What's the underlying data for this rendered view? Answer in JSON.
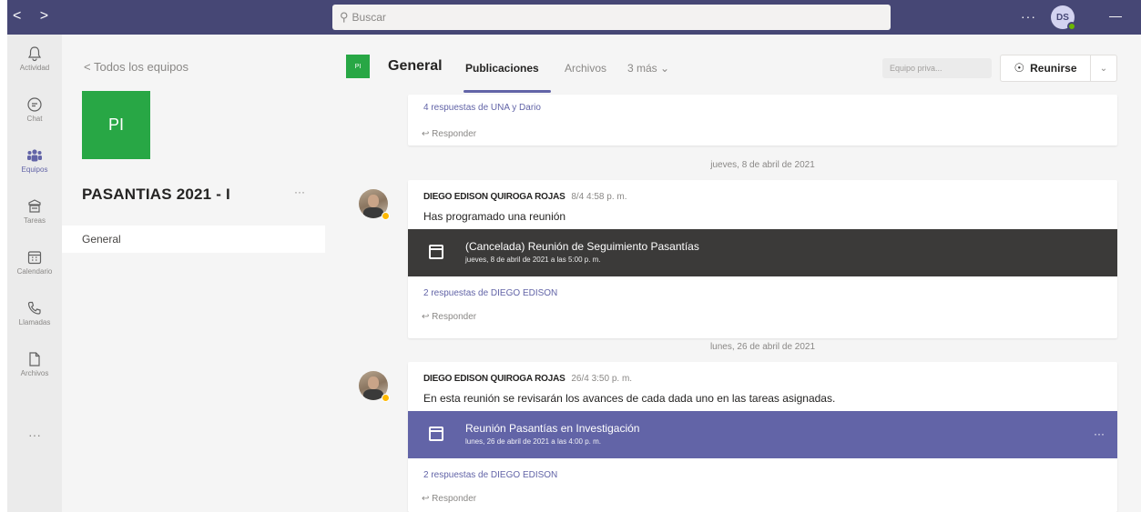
{
  "topbar": {
    "back": "<",
    "forward": ">",
    "search_placeholder": "Buscar",
    "more": "···",
    "user_initials": "DS",
    "minimize": "—"
  },
  "rail": [
    {
      "label": "Actividad",
      "icon": "bell-icon"
    },
    {
      "label": "Chat",
      "icon": "chat-icon"
    },
    {
      "label": "Equipos",
      "icon": "teams-icon",
      "active": true
    },
    {
      "label": "Tareas",
      "icon": "assignments-icon"
    },
    {
      "label": "Calendario",
      "icon": "calendar-icon"
    },
    {
      "label": "Llamadas",
      "icon": "phone-icon"
    },
    {
      "label": "Archivos",
      "icon": "files-icon"
    }
  ],
  "rail_more": "···",
  "team": {
    "back_label": "< Todos los equipos",
    "tile_initials": "PI",
    "name": "PASANTIAS 2021 - I",
    "more": "···",
    "channel": "General"
  },
  "header": {
    "tile_initials": "PI",
    "channel_title": "General",
    "tabs": [
      "Publicaciones",
      "Archivos",
      "3 más"
    ],
    "privacy": "Equipo priva...",
    "meet_label": "Reunirse",
    "meet_dropdown": "⌄"
  },
  "feed": {
    "top_replies": "4 respuestas de UNA y Dario",
    "reply_label": "Responder",
    "date1": "jueves, 8 de abril de 2021",
    "post1": {
      "sender": "DIEGO EDISON QUIROGA ROJAS",
      "time": "8/4 4:58 p. m.",
      "text": "Has programado una reunión",
      "meeting_title": "(Cancelada) Reunión de Seguimiento Pasantías",
      "meeting_sub": "jueves, 8 de abril de 2021 a las 5:00 p. m.",
      "replies": "2 respuestas de DIEGO EDISON"
    },
    "date2": "lunes, 26 de abril de 2021",
    "post2": {
      "sender": "DIEGO EDISON QUIROGA ROJAS",
      "time": "26/4 3:50 p. m.",
      "text": "En esta reunión se revisarán los avances de cada dada uno en las tareas asignadas.",
      "meeting_title": "Reunión Pasantías en Investigación",
      "meeting_sub": "lunes, 26 de abril de 2021 a las 4:00 p. m.",
      "meeting_more": "···",
      "replies": "2 respuestas de DIEGO EDISON"
    }
  },
  "colors": {
    "brand": "#464775",
    "accent": "#6264a7",
    "team_tile": "#28a745",
    "cancelled_meeting": "#3b3a39",
    "active_meeting": "#6264a7"
  }
}
